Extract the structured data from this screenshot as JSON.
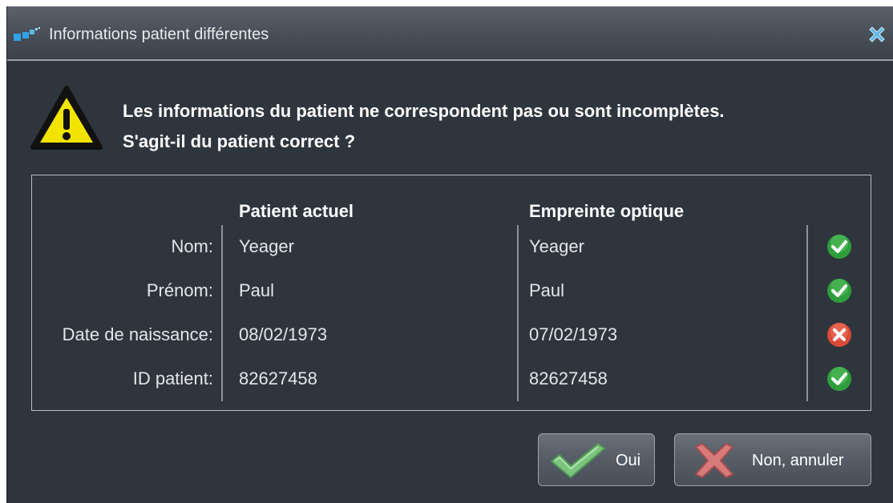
{
  "window": {
    "title": "Informations patient différentes",
    "app_icon": "app-squares-icon",
    "close_icon": "close-icon"
  },
  "message": {
    "icon": "warning-icon",
    "line1": "Les informations du patient ne correspondent pas ou sont incomplètes.",
    "line2": "S'agit-il du patient correct ?"
  },
  "table": {
    "columns": [
      "Patient actuel",
      "Empreinte optique"
    ],
    "rows": [
      {
        "label": "Nom:",
        "current": "Yeager",
        "optical": "Yeager",
        "match": true
      },
      {
        "label": "Prénom:",
        "current": "Paul",
        "optical": "Paul",
        "match": true
      },
      {
        "label": "Date de naissance:",
        "current": "08/02/1973",
        "optical": "07/02/1973",
        "match": false
      },
      {
        "label": "ID patient:",
        "current": "82627458",
        "optical": "82627458",
        "match": true
      }
    ]
  },
  "buttons": {
    "yes_label": "Oui",
    "no_label": "Non, annuler"
  },
  "colors": {
    "match_green": "#2e9e3c",
    "mismatch_red": "#d94a36",
    "warning_yellow": "#f2e400"
  }
}
